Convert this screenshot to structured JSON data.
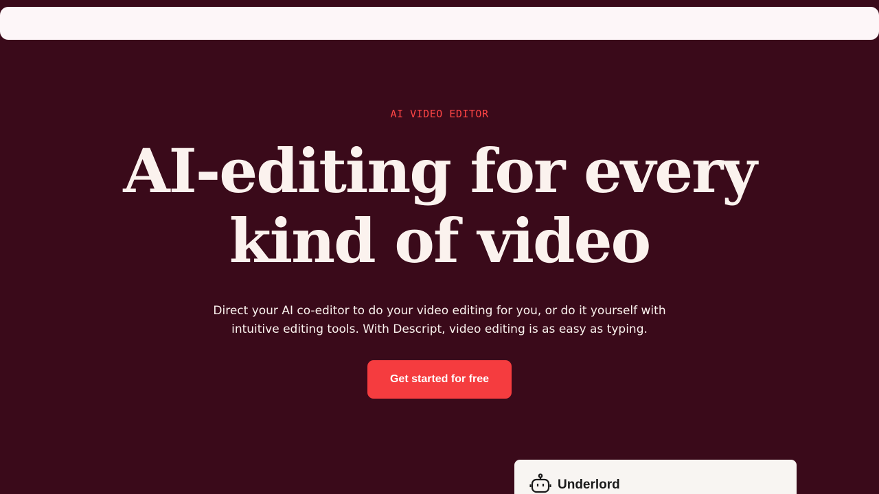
{
  "header": {},
  "hero": {
    "eyebrow": "AI VIDEO EDITOR",
    "headline_line1": "AI-editing for every",
    "headline_line2": "kind of video",
    "description_line1": "Direct your AI co-editor to do your video editing for you, or do it yourself with",
    "description_line2": "intuitive editing tools. With Descript, video editing is as easy as typing.",
    "cta_label": "Get started for free"
  },
  "assistant_panel": {
    "title": "Underlord",
    "icon": "robot-icon"
  },
  "colors": {
    "background": "#3a0a1a",
    "accent": "#f53c3f",
    "eyebrow": "#ff4545",
    "text_light": "#fbf2ee",
    "nav_bar": "#fdf6f8",
    "panel": "#f8f5f2"
  }
}
